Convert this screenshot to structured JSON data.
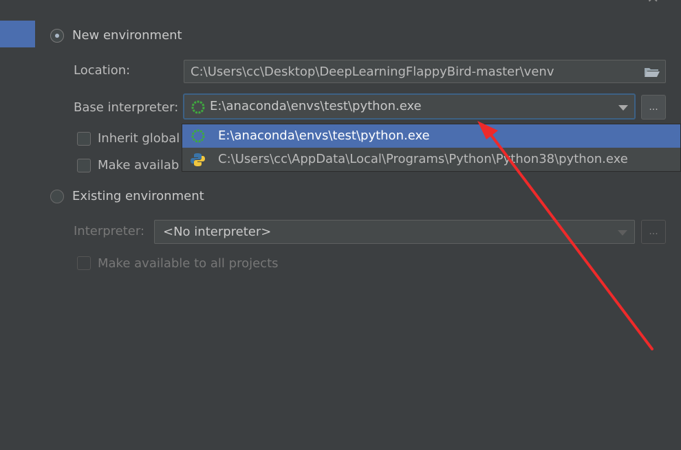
{
  "colors": {
    "background": "#3c3f41",
    "selection": "#4b6eaf",
    "annotation_arrow": "#ee2a2a",
    "anaconda_ring": "#3faa3f",
    "python_blue": "#3a74a8",
    "python_yellow": "#f0c63f"
  },
  "new_env": {
    "radio_label": "New environment",
    "selected": true,
    "location_label": "Location:",
    "location_value": "C:\\Users\\cc\\Desktop\\DeepLearningFlappyBird-master\\venv",
    "base_interpreter_label": "Base interpreter:",
    "base_interpreter_value": "E:\\anaconda\\envs\\test\\python.exe",
    "browse_label": "...",
    "inherit_label": "Inherit global",
    "make_available_label": "Make availab",
    "location_folder_icon": "folder-icon"
  },
  "dropdown": {
    "items": [
      {
        "label": "E:\\anaconda\\envs\\test\\python.exe",
        "icon": "anaconda-icon",
        "selected": true
      },
      {
        "label": "C:\\Users\\cc\\AppData\\Local\\Programs\\Python\\Python38\\python.exe",
        "icon": "python-icon",
        "selected": false
      }
    ]
  },
  "existing_env": {
    "radio_label": "Existing environment",
    "selected": false,
    "interpreter_label": "Interpreter:",
    "interpreter_value": "<No interpreter>",
    "browse_label": "...",
    "make_available_label": "Make available to all projects"
  }
}
